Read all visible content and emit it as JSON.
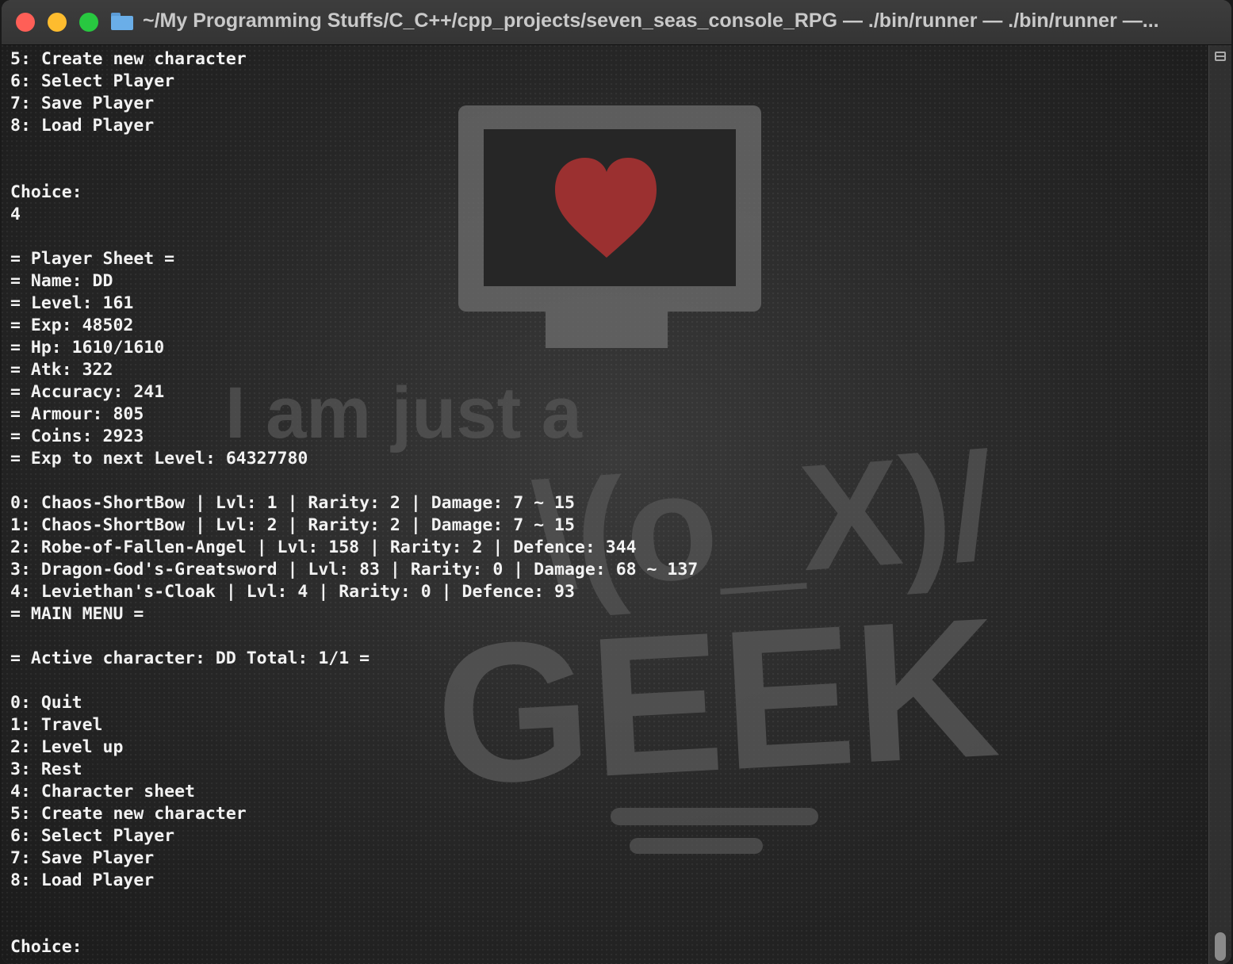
{
  "window": {
    "title": "~/My Programming Stuffs/C_C++/cpp_projects/seven_seas_console_RPG — ./bin/runner — ./bin/runner —..."
  },
  "background": {
    "monitor_color": "#6a6a6a",
    "heart_color": "#a83232",
    "slogan_text": "I am just a",
    "emoticon_text": "\\(o_X)/",
    "big_text": "GEEK"
  },
  "terminal": {
    "lines": [
      "5: Create new character",
      "6: Select Player",
      "7: Save Player",
      "8: Load Player",
      "",
      "",
      "Choice:",
      "4",
      "",
      "= Player Sheet =",
      "= Name: DD",
      "= Level: 161",
      "= Exp: 48502",
      "= Hp: 1610/1610",
      "= Atk: 322",
      "= Accuracy: 241",
      "= Armour: 805",
      "= Coins: 2923",
      "= Exp to next Level: 64327780",
      "",
      "0: Chaos-ShortBow | Lvl: 1 | Rarity: 2 | Damage: 7 ~ 15",
      "1: Chaos-ShortBow | Lvl: 2 | Rarity: 2 | Damage: 7 ~ 15",
      "2: Robe-of-Fallen-Angel | Lvl: 158 | Rarity: 2 | Defence: 344",
      "3: Dragon-God's-Greatsword | Lvl: 83 | Rarity: 0 | Damage: 68 ~ 137",
      "4: Leviethan's-Cloak | Lvl: 4 | Rarity: 0 | Defence: 93",
      "= MAIN MENU =",
      "",
      "= Active character: DD Total: 1/1 =",
      "",
      "0: Quit",
      "1: Travel",
      "2: Level up",
      "3: Rest",
      "4: Character sheet",
      "5: Create new character",
      "6: Select Player",
      "7: Save Player",
      "8: Load Player",
      "",
      "",
      "Choice:"
    ]
  }
}
